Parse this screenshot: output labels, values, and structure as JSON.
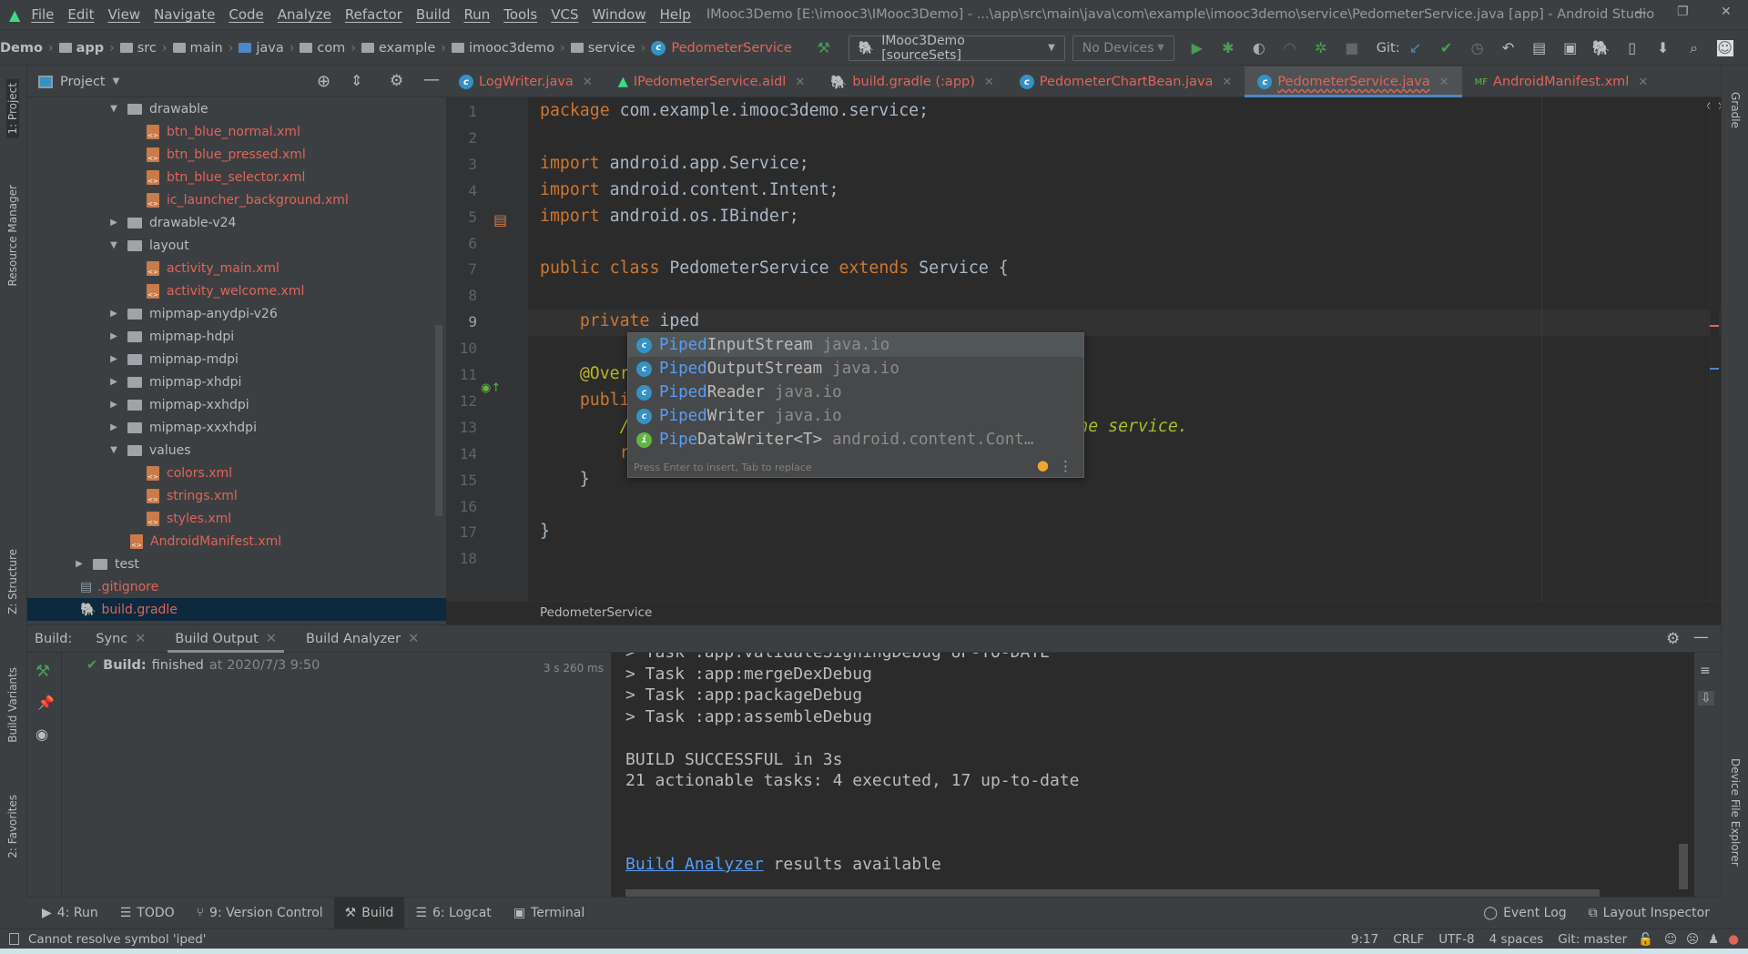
{
  "window": {
    "title": "IMooc3Demo [E:\\imooc3\\IMooc3Demo] - ...\\app\\src\\main\\java\\com\\example\\imooc3demo\\service\\PedometerService.java [app] - Android Studio",
    "minimize": "—",
    "restore": "❐",
    "close": "✕"
  },
  "menu": [
    "File",
    "Edit",
    "View",
    "Navigate",
    "Code",
    "Analyze",
    "Refactor",
    "Build",
    "Run",
    "Tools",
    "VCS",
    "Window",
    "Help"
  ],
  "breadcrumb": [
    "Demo",
    "app",
    "src",
    "main",
    "java",
    "com",
    "example",
    "imooc3demo",
    "service",
    "PedometerService"
  ],
  "toolbar": {
    "run_config": "IMooc3Demo [sourceSets]",
    "device": "No Devices",
    "git_label": "Git:"
  },
  "project": {
    "title": "Project",
    "items": [
      {
        "label": "drawable",
        "type": "folder",
        "expanded": true
      },
      {
        "label": "btn_blue_normal.xml",
        "type": "xml"
      },
      {
        "label": "btn_blue_pressed.xml",
        "type": "xml"
      },
      {
        "label": "btn_blue_selector.xml",
        "type": "xml"
      },
      {
        "label": "ic_launcher_background.xml",
        "type": "xml"
      },
      {
        "label": "drawable-v24",
        "type": "folder",
        "expanded": false
      },
      {
        "label": "layout",
        "type": "folder",
        "expanded": true
      },
      {
        "label": "activity_main.xml",
        "type": "xml"
      },
      {
        "label": "activity_welcome.xml",
        "type": "xml"
      },
      {
        "label": "mipmap-anydpi-v26",
        "type": "folder",
        "expanded": false
      },
      {
        "label": "mipmap-hdpi",
        "type": "folder",
        "expanded": false
      },
      {
        "label": "mipmap-mdpi",
        "type": "folder",
        "expanded": false
      },
      {
        "label": "mipmap-xhdpi",
        "type": "folder",
        "expanded": false
      },
      {
        "label": "mipmap-xxhdpi",
        "type": "folder",
        "expanded": false
      },
      {
        "label": "mipmap-xxxhdpi",
        "type": "folder",
        "expanded": false
      },
      {
        "label": "values",
        "type": "folder",
        "expanded": true
      },
      {
        "label": "colors.xml",
        "type": "xml"
      },
      {
        "label": "strings.xml",
        "type": "xml"
      },
      {
        "label": "styles.xml",
        "type": "xml"
      },
      {
        "label": "AndroidManifest.xml",
        "type": "xml"
      },
      {
        "label": "test",
        "type": "folder",
        "expanded": false
      },
      {
        "label": ".gitignore",
        "type": "file"
      },
      {
        "label": "build.gradle",
        "type": "gradle",
        "selected": true
      }
    ]
  },
  "tabs": [
    {
      "label": "LogWriter.java",
      "icon": "class-icon"
    },
    {
      "label": "IPedometerService.aidl",
      "icon": "android-icon"
    },
    {
      "label": "build.gradle (:app)",
      "icon": "gradle-icon"
    },
    {
      "label": "PedometerChartBean.java",
      "icon": "class-icon"
    },
    {
      "label": "PedometerService.java",
      "icon": "class-icon",
      "active": true
    },
    {
      "label": "AndroidManifest.xml",
      "icon": "manifest-icon"
    }
  ],
  "editor": {
    "lines": [
      "package com.example.imooc3demo.service;",
      "",
      "import android.app.Service;",
      "import android.content.Intent;",
      "import android.os.IBinder;",
      "",
      "public class PedometerService extends Service {",
      "",
      "    private iped",
      "",
      "    @Override",
      "    public IBinder onBind(Intent intent) {",
      "        // TODO: Return the communication channel to the service.",
      "        return null;",
      "    }",
      "",
      "}",
      ""
    ],
    "footer": "PedometerService"
  },
  "completion": {
    "items": [
      {
        "match": "Piped",
        "rest": "InputStream",
        "pkg": "java.io",
        "kind": "c"
      },
      {
        "match": "Piped",
        "rest": "OutputStream",
        "pkg": "java.io",
        "kind": "c"
      },
      {
        "match": "Piped",
        "rest": "Reader",
        "pkg": "java.io",
        "kind": "c"
      },
      {
        "match": "Piped",
        "rest": "Writer",
        "pkg": "java.io",
        "kind": "c"
      },
      {
        "match": "Pipe",
        "rest": "DataWriter<T>",
        "pkg": "android.content.Cont…",
        "kind": "i"
      }
    ],
    "hint": "Press Enter to insert, Tab to replace"
  },
  "build": {
    "label": "Build:",
    "tabs": [
      "Sync",
      "Build Output",
      "Build Analyzer"
    ],
    "status_title": "Build:",
    "status_text": "finished",
    "status_time": "at 2020/7/3 9:50",
    "duration": "3 s 260 ms",
    "console": [
      "> Task :app:validateSigningDebug UP-TO-DATE",
      "> Task :app:mergeDexDebug",
      "> Task :app:packageDebug",
      "> Task :app:assembleDebug",
      "",
      "BUILD SUCCESSFUL in 3s",
      "21 actionable tasks: 4 executed, 17 up-to-date",
      ""
    ],
    "analyzer_link": "Build Analyzer",
    "analyzer_rest": " results available"
  },
  "side_left": [
    "1: Project",
    "Resource Manager",
    "Z: Structure",
    "Build Variants",
    "2: Favorites"
  ],
  "side_right": [
    "Gradle",
    "Device File Explorer"
  ],
  "bottom_tools": [
    "4: Run",
    "TODO",
    "9: Version Control",
    "Build",
    "6: Logcat",
    "Terminal"
  ],
  "bottom_right": [
    "Event Log",
    "Layout Inspector"
  ],
  "status": {
    "message": "Cannot resolve symbol 'iped'",
    "position": "9:17",
    "line_sep": "CRLF",
    "encoding": "UTF-8",
    "indent": "4 spaces",
    "branch": "Git: master"
  },
  "colors": {
    "accent": "#4a88c7",
    "error": "#e0645a",
    "keyword": "#cc7832",
    "success": "#499c54"
  }
}
